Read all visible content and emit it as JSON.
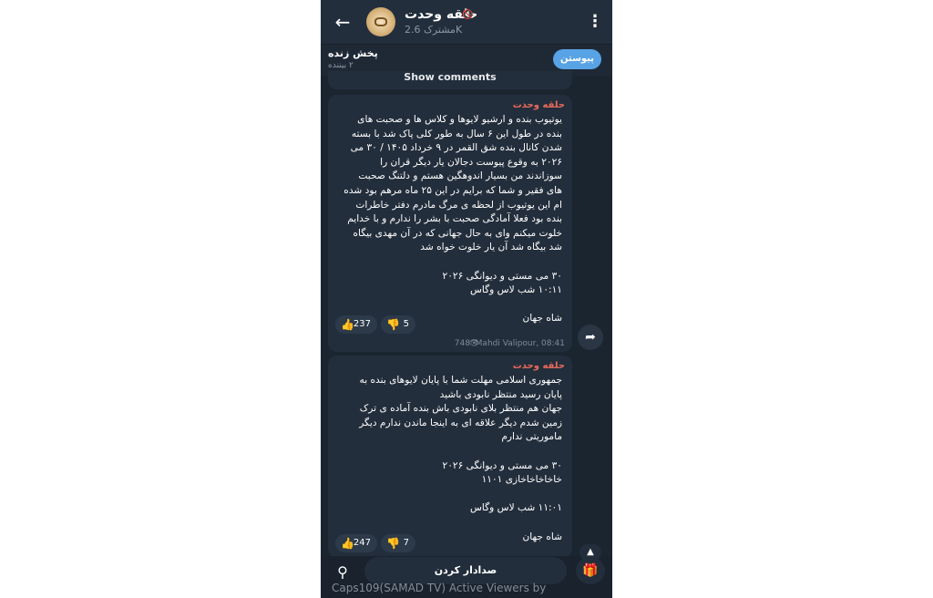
{
  "channel": {
    "name": "حلقه وحدت",
    "subscribers": "مشترک 2.6K",
    "back_icon": "arrow-left-icon",
    "menu_icon": "more-vertical-icon",
    "muted_icon": "speaker-muted-icon"
  },
  "live": {
    "title": "پخش زنده",
    "viewers": "۲ بیننده",
    "join_label": "پیوستن"
  },
  "show_comments": "Show comments",
  "messages": [
    {
      "author": "حلقه وحدت",
      "text": "یوتیوب بنده و ارشیو لایوها و کلاس ها و صحبت های بنده در طول این ۶ سال به طور کلی پاک شد با بسته شدن کانال بنده شق القمر در ۹ خرداد ۱۴۰۵ / ۳۰ می ۲۰۲۶ به وقوع پیوست دجالان یار دیگر قران را سوزاندند من بسیار اندوهگین هستم و دلتنگ صحبت های فقیر و شما که برایم در این ۲۵ ماه مرهم بود شده ام این یوتیوب از لحظه ی مرگ مادرم دفتر خاطرات بنده بود فعلا آمادگی صحبت با بشر را ندارم و با خدایم خلوت میکنم وای به حال جهانی که در آن مهدی بیگاه شد بیگاه شد آن یار خلوت خواه شد\n\n۳۰ می مستی و دیوانگی ۲۰۲۶\n۱۰:۱۱ شب لاس وگاس\n\nشاه جهان",
      "likes": "237",
      "dislikes": "5",
      "views": "748",
      "signature": "Mahdi Valipour, 08:41"
    },
    {
      "author": "حلقه وحدت",
      "text": "جمهوری اسلامی مهلت شما با پایان لایوهای بنده به پایان رسید منتظر نابودی باشید\nجهان هم منتظر بلای نابودی باش بنده آماده ی ترک زمین شدم دیگر علاقه ای به اینجا ماندن ندارم دیگر ماموریتی ندارم\n\n۳۰ می مستی و دیوانگی ۲۰۲۶\nخاخاخاخاخازی ۱۱۰۱\n\n۱۱:۰۱ شب لاس وگاس\n\nشاه جهان",
      "likes": "247",
      "dislikes": "7"
    }
  ],
  "icons": {
    "like": "thumbs-up-icon",
    "dislike": "thumbs-down-icon",
    "eye": "eye-icon",
    "share": "share-icon",
    "search": "search-icon",
    "gift": "gift-icon",
    "scroll": "chevron-up-icon"
  },
  "mute_label": "صدادار کردن",
  "watermark": "Caps109(SAMAD TV) Active Viewers by"
}
